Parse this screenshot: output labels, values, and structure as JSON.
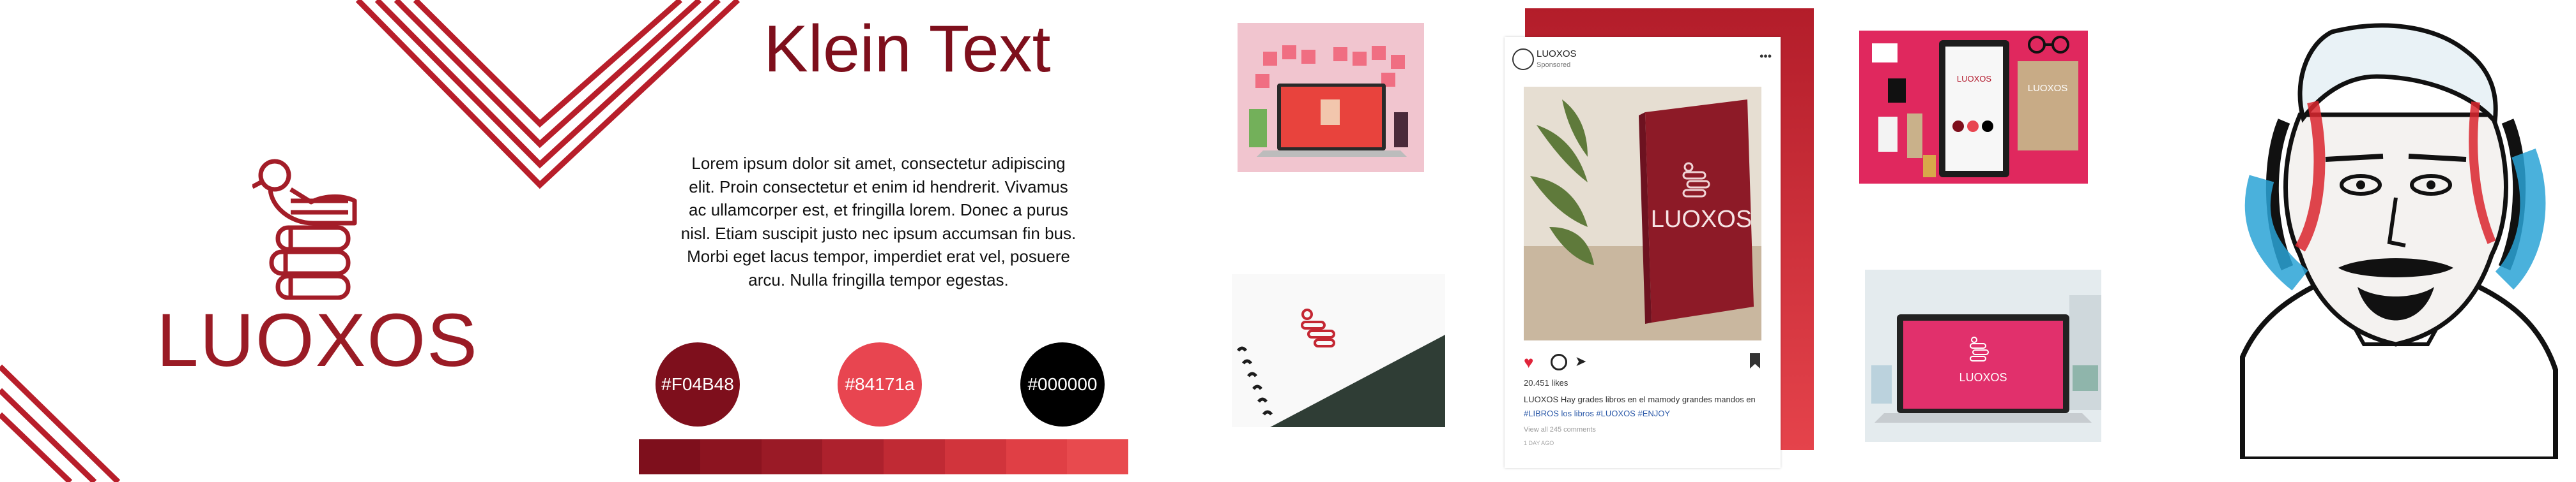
{
  "brand": {
    "name": "LUOXOS"
  },
  "headline": "Klein Text",
  "body_text": "Lorem ipsum dolor sit amet, consectetur adipiscing elit. Proin consectetur et  enim id hendrerit. Vivamus ac ullamcorper est, et fringilla lorem. Donec a purus nisl. Etiam suscipit justo nec ipsum accumsan fin bus. Morbi eget lacus  tempor, imperdiet erat vel, posuere arcu. Nulla fringilla tempor egestas.",
  "palette": [
    {
      "label": "#F04B48",
      "color": "#7e0f1c"
    },
    {
      "label": "#84171a",
      "color": "#e84550"
    },
    {
      "label": "#000000",
      "color": "#000000"
    }
  ],
  "gradient_steps": [
    "#7e0f1c",
    "#8c1420",
    "#9a1a26",
    "#ad212d",
    "#c02a34",
    "#d1343c",
    "#e03f45",
    "#e84a4e"
  ],
  "instagram": {
    "account": "LUOXOS",
    "sponsored": "Sponsored",
    "cover_text": "LUOXOS",
    "likes": "20.451 likes",
    "caption_account": "LUOXOS",
    "caption": "Hay grades libros en el mamody grandes mandos en",
    "hashtags": "#LIBROS  los libros  #LUOXOS #ENJOY",
    "comments": "View all 245 comments",
    "time": "1 DAY AGO"
  },
  "mockups": {
    "flatlay_label": "LUOXOS",
    "laptop_label": "LUOXOS"
  },
  "colors": {
    "brand_red": "#9a1b25",
    "accent": "#e84550"
  }
}
